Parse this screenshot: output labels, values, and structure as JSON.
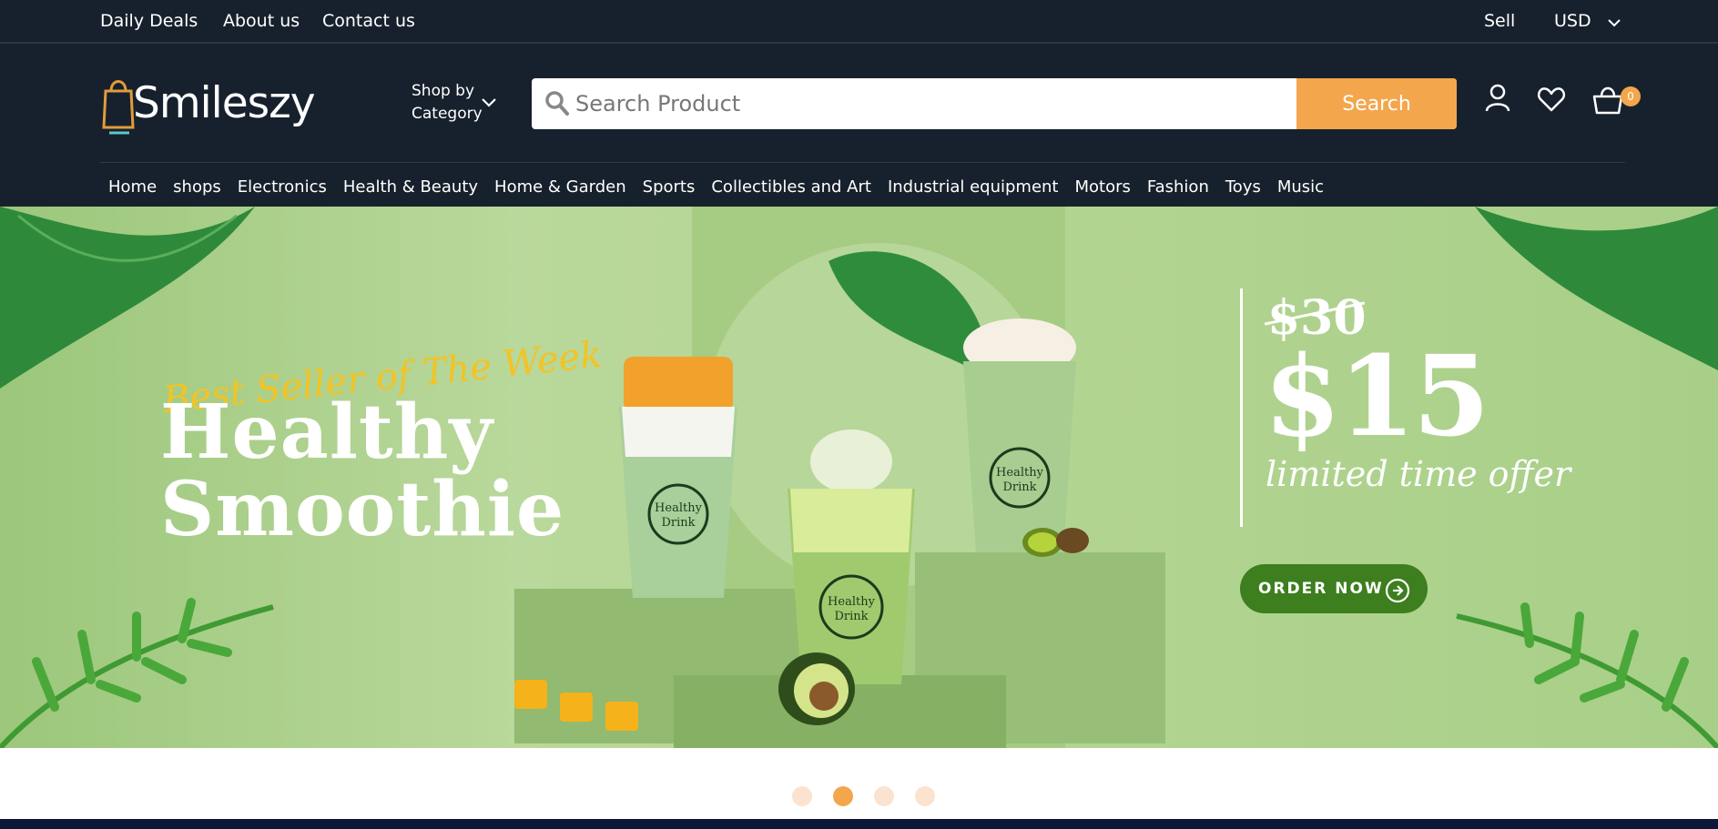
{
  "topbar": {
    "links": [
      "Daily Deals",
      "About us",
      "Contact us"
    ],
    "sell_label": "Sell",
    "currency": "USD"
  },
  "header": {
    "logo_text": "Smileszy",
    "shop_by_line1": "Shop by",
    "shop_by_line2": "Category",
    "search_placeholder": "Search Product",
    "search_button": "Search",
    "cart_count": "0"
  },
  "nav": {
    "items": [
      "Home",
      "shops",
      "Electronics",
      "Health & Beauty",
      "Home & Garden",
      "Sports",
      "Collectibles and Art",
      "Industrial equipment",
      "Motors",
      "Fashion",
      "Toys",
      "Music"
    ]
  },
  "banner": {
    "tagline": "Best Seller of The Week",
    "headline_line1": "Healthy",
    "headline_line2": "Smoothie",
    "old_price": "$30",
    "new_price": "$15",
    "offer_text": "limited time offer",
    "cta_label": "ORDER NOW",
    "cup_label_line1": "Healthy",
    "cup_label_line2": "Drink"
  },
  "carousel": {
    "dot_count": 4,
    "active_index": 1
  },
  "colors": {
    "header_bg": "#17212d",
    "accent": "#f3a64c",
    "banner_green": "#b3d592",
    "cta_green": "#3d7e1e"
  }
}
